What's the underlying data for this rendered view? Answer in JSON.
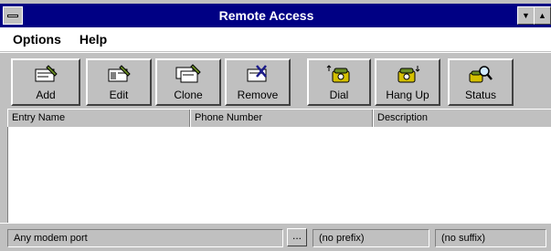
{
  "window": {
    "title": "Remote Access",
    "min_glyph": "▼",
    "max_glyph": "▲"
  },
  "menu": [
    {
      "label": "Options"
    },
    {
      "label": "Help"
    }
  ],
  "toolbar": [
    {
      "label": "Add",
      "icon": "add-entry-icon"
    },
    {
      "label": "Edit",
      "icon": "edit-entry-icon"
    },
    {
      "label": "Clone",
      "icon": "clone-entry-icon"
    },
    {
      "label": "Remove",
      "icon": "remove-entry-icon"
    },
    {
      "label": "Dial",
      "icon": "dial-phone-icon"
    },
    {
      "label": "Hang Up",
      "icon": "hangup-phone-icon"
    },
    {
      "label": "Status",
      "icon": "status-magnifier-icon"
    }
  ],
  "columns": [
    "Entry Name",
    "Phone Number",
    "Description"
  ],
  "status": {
    "port": "Any modem port",
    "browse_label": "...",
    "prefix": "(no prefix)",
    "suffix": "(no suffix)"
  },
  "colors": {
    "titlebar": "#000084",
    "face": "#c0c0c0",
    "icon_green": "#6b8e23",
    "icon_yellow": "#d4c000"
  }
}
